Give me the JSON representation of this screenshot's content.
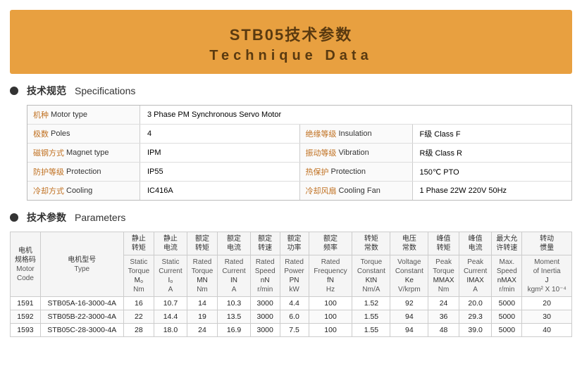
{
  "header": {
    "title_cn": "STB05技术参数",
    "title_en": "Technique Data"
  },
  "specs_section": {
    "dot": true,
    "title_cn": "技术规范",
    "title_en": "Specifications",
    "rows": [
      {
        "left_label_cn": "机种",
        "left_label_en": "Motor type",
        "left_value": "3 Phase PM Synchronous Servo Motor",
        "right_label_cn": "",
        "right_label_en": "",
        "right_value": ""
      },
      {
        "left_label_cn": "极数",
        "left_label_en": "Poles",
        "left_value": "4",
        "right_label_cn": "绝缘等级",
        "right_label_en": "Insulation",
        "right_value": "F级  Class F"
      },
      {
        "left_label_cn": "磁钢方式",
        "left_label_en": "Magnet type",
        "left_value": "IPM",
        "right_label_cn": "振动等级",
        "right_label_en": "Vibration",
        "right_value": "R级  Class R"
      },
      {
        "left_label_cn": "防护等级",
        "left_label_en": "Protection",
        "left_value": "IP55",
        "right_label_cn": "热保护",
        "right_label_en": "Protection",
        "right_value": "150℃ PTO"
      },
      {
        "left_label_cn": "冷却方式",
        "left_label_en": "Cooling",
        "left_value": "IC416A",
        "right_label_cn": "冷却风扇",
        "right_label_en": "Cooling Fan",
        "right_value": "1 Phase  22W  220V  50Hz"
      }
    ]
  },
  "params_section": {
    "dot": true,
    "title_cn": "技术参数",
    "title_en": "Parameters",
    "columns": [
      {
        "cn": "电机规格码",
        "en": "Motor Code",
        "sym": "",
        "unit": ""
      },
      {
        "cn": "电机型号",
        "en": "Type",
        "sym": "",
        "unit": ""
      },
      {
        "cn": "静止转矩",
        "en": "Static Torque",
        "sym": "M₀",
        "unit": "Nm"
      },
      {
        "cn": "静止电流",
        "en": "Static Current",
        "sym": "I₀",
        "unit": "A"
      },
      {
        "cn": "额定转矩",
        "en": "Rated Torque",
        "sym": "MN",
        "unit": "Nm"
      },
      {
        "cn": "额定电流",
        "en": "Rated Current",
        "sym": "IN",
        "unit": "A"
      },
      {
        "cn": "额定转速",
        "en": "Rated Speed",
        "sym": "nN",
        "unit": "r/min"
      },
      {
        "cn": "额定功率",
        "en": "Rated Power",
        "sym": "PN",
        "unit": "kW"
      },
      {
        "cn": "额定频率",
        "en": "Rated Frequency",
        "sym": "fN",
        "unit": "Hz"
      },
      {
        "cn": "转矩常数",
        "en": "Torque Constant",
        "sym": "KtN",
        "unit": "Nm/A"
      },
      {
        "cn": "电压常数",
        "en": "Voltage Constant",
        "sym": "Ke",
        "unit": "V/krpm"
      },
      {
        "cn": "峰值转矩",
        "en": "Peak Torque",
        "sym": "MMAX",
        "unit": "Nm"
      },
      {
        "cn": "峰值电流",
        "en": "Peak Current",
        "sym": "IMAX",
        "unit": "A"
      },
      {
        "cn": "最大允许转速",
        "en": "Max. Speed",
        "sym": "nMAX",
        "unit": "r/min"
      },
      {
        "cn": "转动惯量",
        "en": "Moment of Inertia",
        "sym": "J",
        "unit": "kgm² X 10⁻⁴"
      }
    ],
    "rows": [
      {
        "code": "1591",
        "type": "STB05A-16-3000-4A",
        "M0": "16",
        "I0": "10.7",
        "MN": "14",
        "IN": "10.3",
        "nN": "3000",
        "PN": "4.4",
        "fN": "100",
        "KtN": "1.52",
        "Ke": "92",
        "MMAX": "24",
        "IMAX": "20.0",
        "nMAX": "5000",
        "J": "20"
      },
      {
        "code": "1592",
        "type": "STB05B-22-3000-4A",
        "M0": "22",
        "I0": "14.4",
        "MN": "19",
        "IN": "13.5",
        "nN": "3000",
        "PN": "6.0",
        "fN": "100",
        "KtN": "1.55",
        "Ke": "94",
        "MMAX": "36",
        "IMAX": "29.3",
        "nMAX": "5000",
        "J": "30"
      },
      {
        "code": "1593",
        "type": "STB05C-28-3000-4A",
        "M0": "28",
        "I0": "18.0",
        "MN": "24",
        "IN": "16.9",
        "nN": "3000",
        "PN": "7.5",
        "fN": "100",
        "KtN": "1.55",
        "Ke": "94",
        "MMAX": "48",
        "IMAX": "39.0",
        "nMAX": "5000",
        "J": "40"
      }
    ]
  }
}
